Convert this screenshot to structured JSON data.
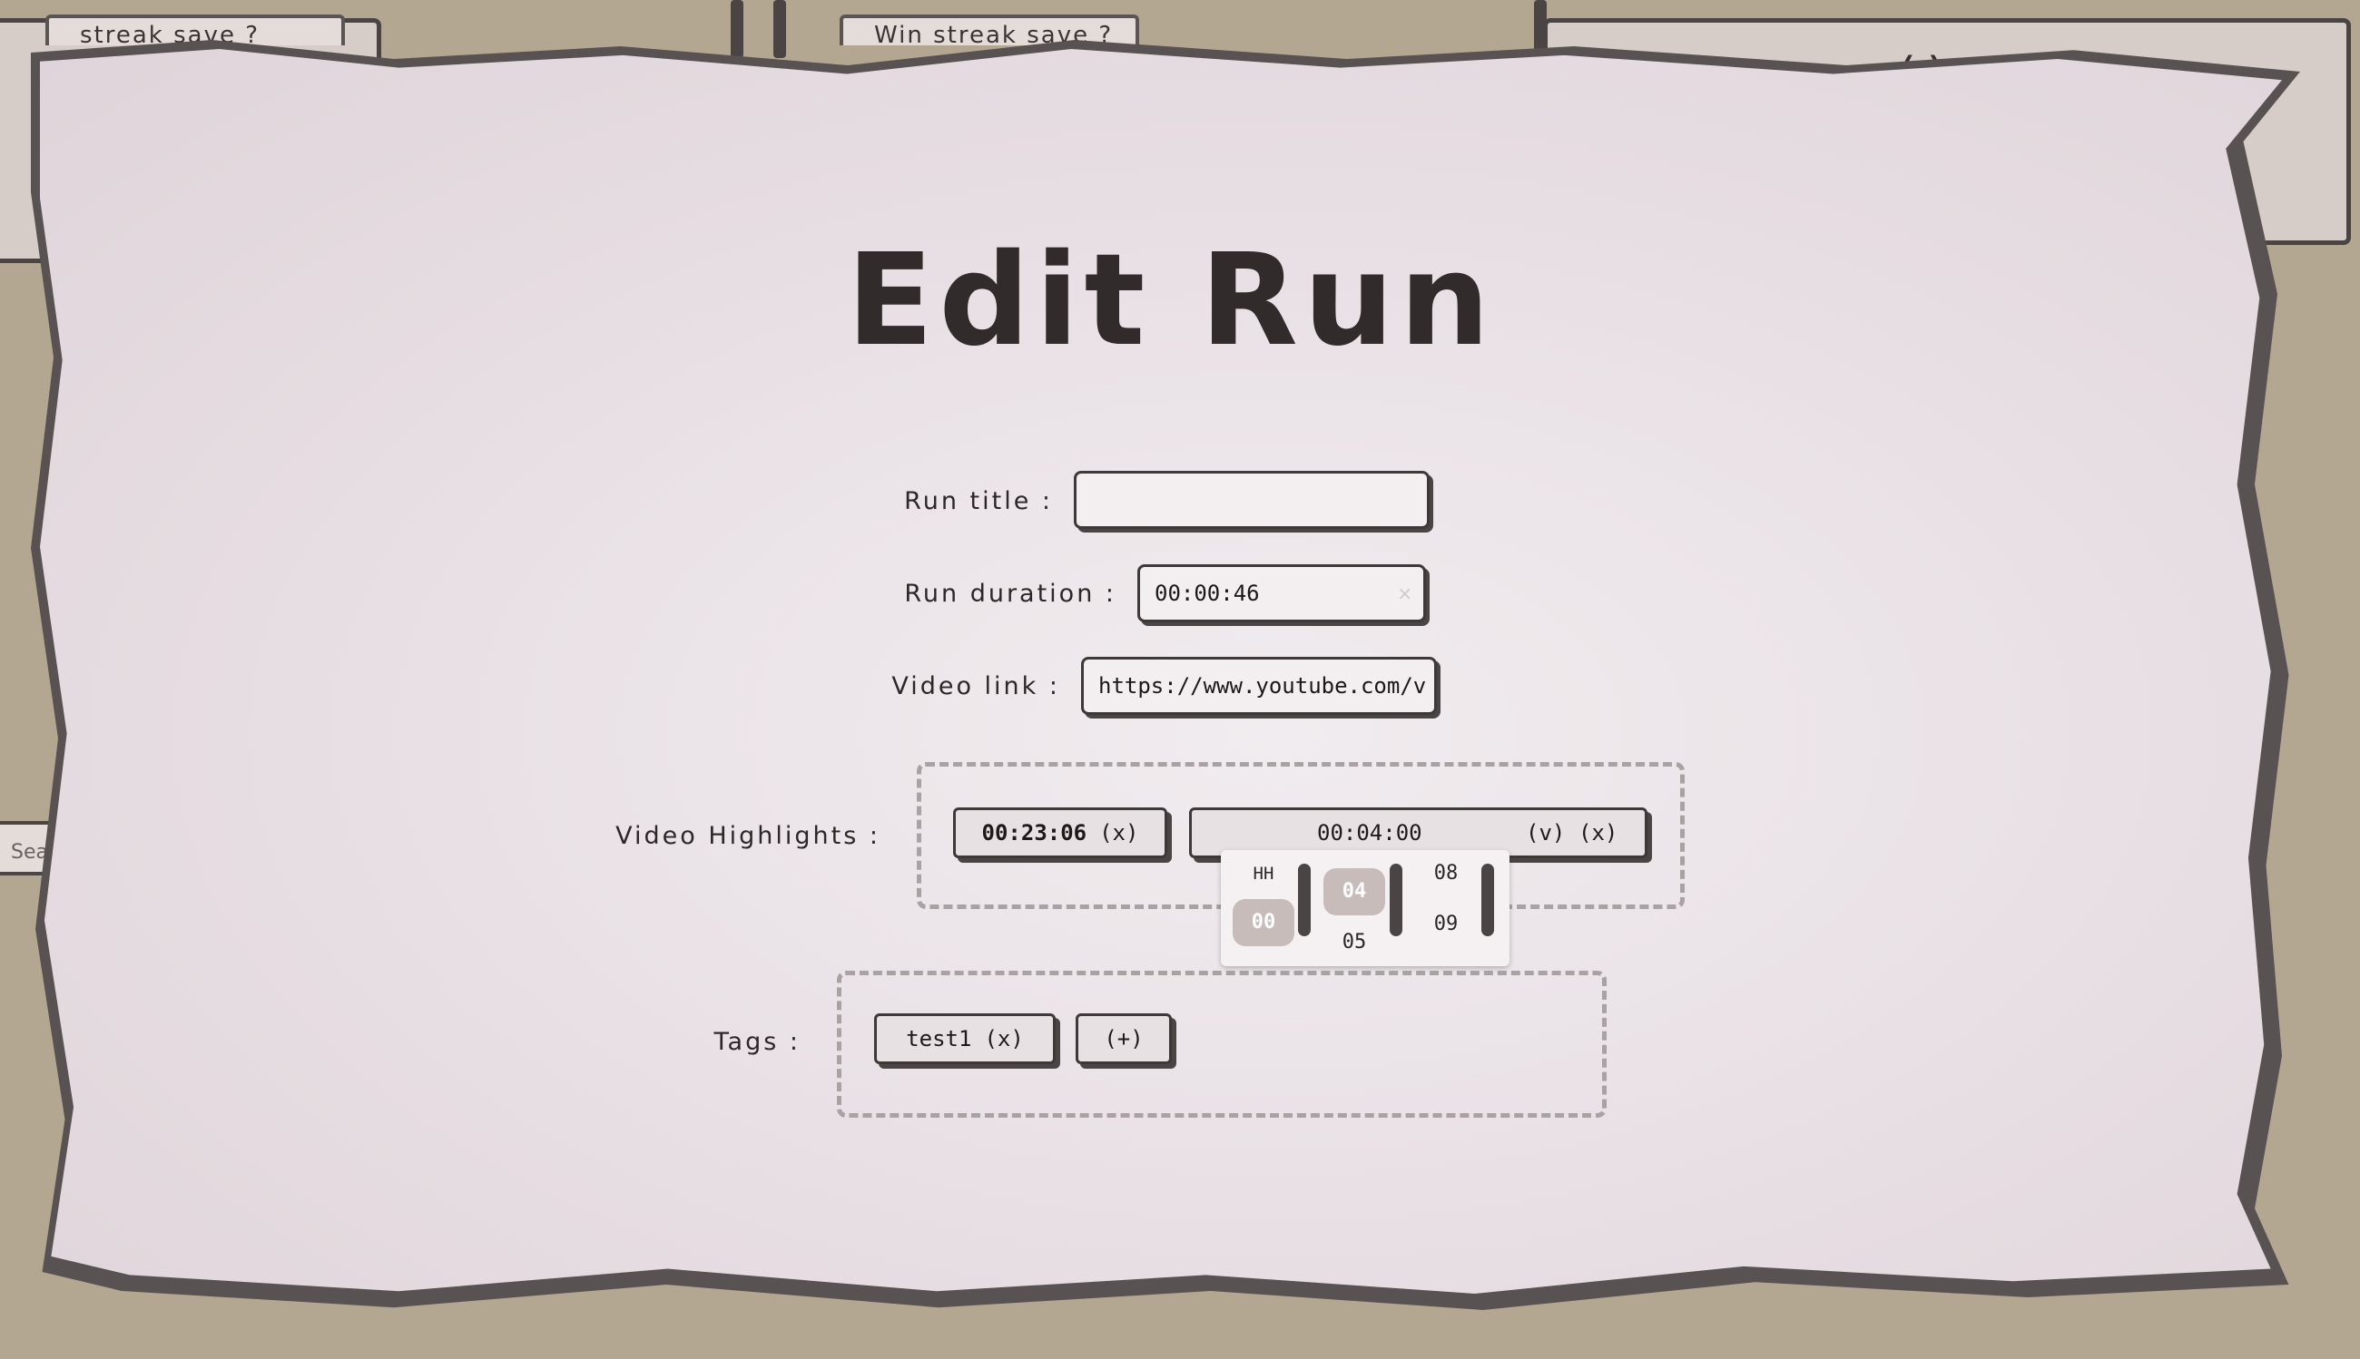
{
  "background": {
    "tabs": [
      {
        "label": "streak save ?"
      },
      {
        "label": "Win streak save ?"
      }
    ],
    "side_chip": "Sea",
    "corner_icon": "(-)"
  },
  "dialog": {
    "title": "Edit Run",
    "run_title": {
      "label": "Run title :",
      "value": ""
    },
    "run_duration": {
      "label": "Run duration :",
      "value": "00:00:46",
      "clear_glyph": "×"
    },
    "video_link": {
      "label": "Video link :",
      "value": "https://www.youtube.com/v"
    },
    "video_highlights": {
      "label": "Video Highlights :",
      "items": [
        {
          "time": "00:23:06",
          "remove": "(x)"
        },
        {
          "time": "00:04:00",
          "confirm": "(v)",
          "remove": "(x)"
        }
      ]
    },
    "time_picker": {
      "col1": {
        "header": "HH",
        "selected": "00"
      },
      "col2": {
        "selected": "04",
        "next": "05"
      },
      "col3": {
        "above": "08",
        "below": "09"
      }
    },
    "tags": {
      "label": "Tags :",
      "items": [
        {
          "name": "test1",
          "remove": "(x)"
        }
      ],
      "add": "(+)"
    }
  }
}
